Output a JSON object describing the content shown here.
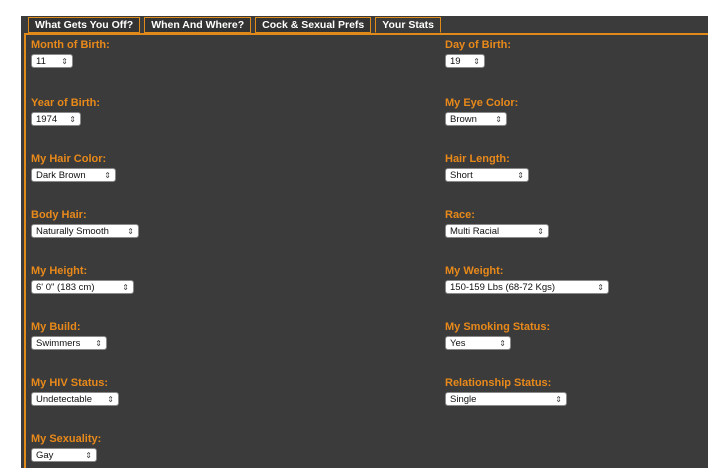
{
  "tabs": [
    {
      "label": "What Gets You Off?",
      "active": false
    },
    {
      "label": "When And Where?",
      "active": false
    },
    {
      "label": "Cock & Sexual Prefs",
      "active": false
    },
    {
      "label": "Your Stats",
      "active": true
    }
  ],
  "fields": {
    "month_of_birth": {
      "label": "Month of Birth:",
      "value": "11"
    },
    "day_of_birth": {
      "label": "Day of Birth:",
      "value": "19"
    },
    "year_of_birth": {
      "label": "Year of Birth:",
      "value": "1974"
    },
    "eye_color": {
      "label": "My Eye Color:",
      "value": "Brown"
    },
    "hair_color": {
      "label": "My Hair Color:",
      "value": "Dark Brown"
    },
    "hair_length": {
      "label": "Hair Length:",
      "value": "Short"
    },
    "body_hair": {
      "label": "Body Hair:",
      "value": "Naturally Smooth"
    },
    "race": {
      "label": "Race:",
      "value": "Multi Racial"
    },
    "height": {
      "label": "My Height:",
      "value": "6' 0\" (183 cm)"
    },
    "weight": {
      "label": "My Weight:",
      "value": "150-159 Lbs (68-72 Kgs)"
    },
    "build": {
      "label": "My Build:",
      "value": "Swimmers"
    },
    "smoking_status": {
      "label": "My Smoking Status:",
      "value": "Yes"
    },
    "hiv_status": {
      "label": "My HIV Status:",
      "value": "Undetectable"
    },
    "relationship_status": {
      "label": "Relationship Status:",
      "value": "Single"
    },
    "sexuality": {
      "label": "My Sexuality:",
      "value": "Gay"
    }
  },
  "colors": {
    "accent": "#e8891a",
    "panel": "#3b3b3b"
  }
}
